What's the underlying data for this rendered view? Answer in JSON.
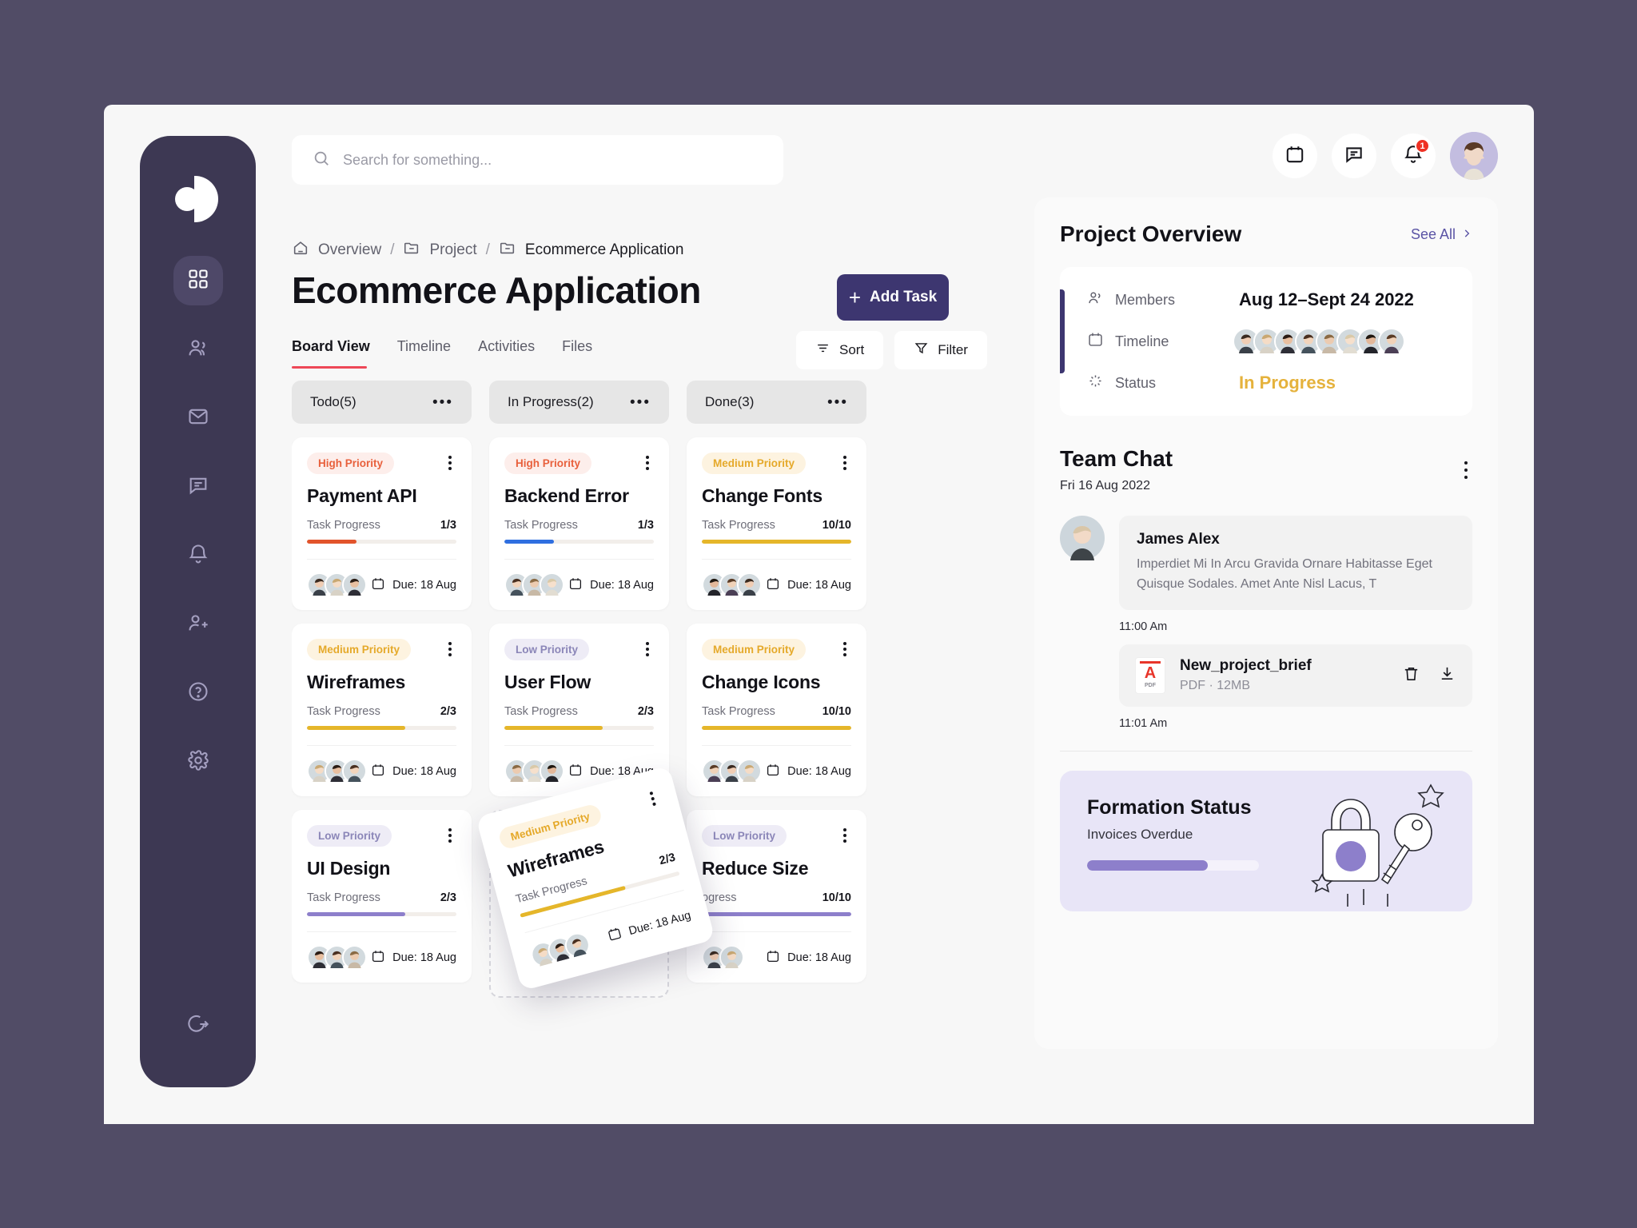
{
  "window": {
    "bg_color": "#514c66",
    "surface_color": "#f7f7f7"
  },
  "sidebar": {
    "logo_name": "app-logo",
    "items": [
      {
        "icon": "grid-icon",
        "name": "dashboard",
        "active": true
      },
      {
        "icon": "users-icon",
        "name": "team",
        "active": false
      },
      {
        "icon": "mail-icon",
        "name": "messages",
        "active": false
      },
      {
        "icon": "chat-icon",
        "name": "chat",
        "active": false
      },
      {
        "icon": "bell-icon",
        "name": "notifications",
        "active": false
      },
      {
        "icon": "user-add-icon",
        "name": "invite",
        "active": false
      },
      {
        "icon": "help-icon",
        "name": "help",
        "active": false
      },
      {
        "icon": "gear-icon",
        "name": "settings",
        "active": false
      }
    ],
    "logout": {
      "icon": "logout-icon",
      "name": "logout"
    }
  },
  "search": {
    "placeholder": "Search for something...",
    "value": ""
  },
  "topbar": {
    "calendar_icon": "calendar-icon",
    "chat_icon": "chat-bubble-icon",
    "bell_icon": "bell-icon",
    "notification_count": "1",
    "avatar_name": "user-avatar"
  },
  "breadcrumb": {
    "home": "Overview",
    "sep1": "/",
    "project": "Project",
    "sep2": "/",
    "current": "Ecommerce Application"
  },
  "page": {
    "title": "Ecommerce Application"
  },
  "actions": {
    "add_task": "Add Task",
    "sort": "Sort",
    "filter": "Filter"
  },
  "tabs": [
    {
      "label": "Board View",
      "active": true
    },
    {
      "label": "Timeline",
      "active": false
    },
    {
      "label": "Activities",
      "active": false
    },
    {
      "label": "Files",
      "active": false
    }
  ],
  "accent": {
    "primary": "#3d3670",
    "tab_underline": "#ee4757",
    "high": "#e8603c",
    "medium": "#e5a92a",
    "low": "#8b86b8",
    "status": "#e5b23c"
  },
  "board": {
    "columns": [
      {
        "title": "Todo(5)",
        "menu": "•••",
        "cards": [
          {
            "priority": "High Priority",
            "priority_level": "high",
            "title": "Payment API",
            "progress_label": "Task Progress",
            "progress_value": "1/3",
            "progress_pct": 33,
            "progress_color": "#e2542c",
            "due": "Due: 18 Aug",
            "avatars": 3
          },
          {
            "priority": "Medium Priority",
            "priority_level": "medium",
            "title": "Wireframes",
            "progress_label": "Task Progress",
            "progress_value": "2/3",
            "progress_pct": 66,
            "progress_color": "#e5b62a",
            "due": "Due: 18 Aug",
            "avatars": 3
          },
          {
            "priority": "Low Priority",
            "priority_level": "low",
            "title": "UI Design",
            "progress_label": "Task Progress",
            "progress_value": "2/3",
            "progress_pct": 66,
            "progress_color": "#8d7fcb",
            "due": "Due: 18 Aug",
            "avatars": 3
          }
        ]
      },
      {
        "title": "In Progress(2)",
        "menu": "•••",
        "cards": [
          {
            "priority": "High Priority",
            "priority_level": "high",
            "title": "Backend Error",
            "progress_label": "Task Progress",
            "progress_value": "1/3",
            "progress_pct": 33,
            "progress_color": "#2f6fe0",
            "due": "Due: 18 Aug",
            "avatars": 3
          },
          {
            "priority": "Low Priority",
            "priority_level": "low",
            "title": "User Flow",
            "progress_label": "Task Progress",
            "progress_value": "2/3",
            "progress_pct": 66,
            "progress_color": "#e5b62a",
            "due": "Due: 18 Aug",
            "avatars": 3
          }
        ]
      },
      {
        "title": "Done(3)",
        "menu": "•••",
        "cards": [
          {
            "priority": "Medium Priority",
            "priority_level": "medium",
            "title": "Change Fonts",
            "progress_label": "Task Progress",
            "progress_value": "10/10",
            "progress_pct": 100,
            "progress_color": "#e5b62a",
            "due": "Due: 18 Aug",
            "avatars": 3
          },
          {
            "priority": "Medium Priority",
            "priority_level": "medium",
            "title": "Change Icons",
            "progress_label": "Task Progress",
            "progress_value": "10/10",
            "progress_pct": 100,
            "progress_color": "#e5b62a",
            "due": "Due: 18 Aug",
            "avatars": 3
          },
          {
            "priority": "Low Priority",
            "priority_level": "low",
            "title": "Reduce Size",
            "progress_label": "ogress",
            "progress_value": "10/10",
            "progress_pct": 100,
            "progress_color": "#8d7fcb",
            "due": "Due: 18 Aug",
            "avatars": 2
          }
        ]
      }
    ],
    "dragging_card": {
      "priority": "Medium Priority",
      "priority_level": "medium",
      "title": "Wireframes",
      "progress_label": "Task Progress",
      "progress_value": "2/3",
      "progress_pct": 66,
      "progress_color": "#e5b62a",
      "due": "Due: 18 Aug",
      "avatars": 3
    }
  },
  "overview": {
    "title": "Project Overview",
    "see_all": "See All",
    "rows": [
      {
        "icon": "users-icon",
        "label": "Members",
        "value": "Aug 12–Sept 24 2022",
        "type": "text"
      },
      {
        "icon": "calendar-icon",
        "label": "Timeline",
        "value": "",
        "type": "avatars",
        "avatar_count": 8
      },
      {
        "icon": "spinner-icon",
        "label": "Status",
        "value": "In Progress",
        "type": "status"
      }
    ]
  },
  "chat": {
    "title": "Team Chat",
    "menu": "kebab-menu",
    "date": "Fri 16 Aug 2022",
    "message": {
      "author": "James Alex",
      "text": "Imperdiet Mi In Arcu Gravida Ornare Habitasse Eget Quisque Sodales. Amet Ante Nisl Lacus, T",
      "time": "11:00 Am"
    },
    "file": {
      "name": "New_project_brief",
      "type": "PDF",
      "separator": "·",
      "size": "12MB",
      "delete_icon": "trash-icon",
      "download_icon": "download-icon",
      "time": "11:01 Am"
    }
  },
  "formation": {
    "title": "Formation Status",
    "subtitle": "Invoices Overdue",
    "progress_pct": 70,
    "bar_color": "#8d7fcb",
    "illustration": "lock-and-key-illustration"
  }
}
